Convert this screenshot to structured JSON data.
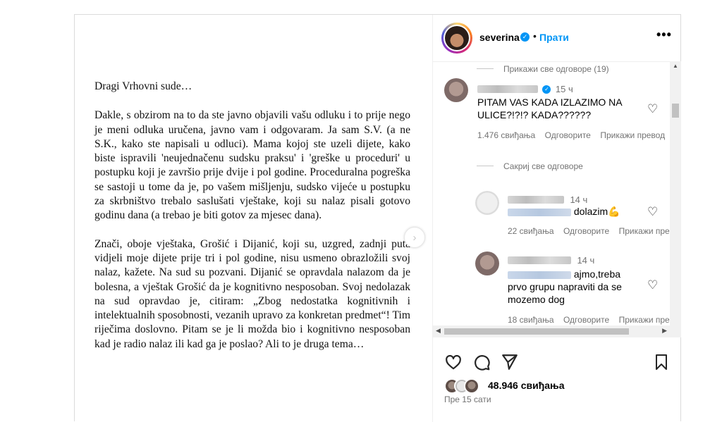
{
  "post": {
    "letter": {
      "greeting": "Dragi Vrhovni sude…",
      "paragraph1": "Dakle, s obzirom na to da ste javno objavili vašu odluku i to prije nego je meni odluka uručena, javno vam i odgovaram. Ja sam S.V. (a ne S.K., kako ste napisali u odluci). Mama kojoj ste uzeli dijete, kako biste ispravili 'neujednačenu sudsku praksu' i 'greške u proceduri' u postupku koji je završio prije dvije i pol godine. Proceduralna pogreška se sastoji u tome da je, po vašem mišljenju, sudsko vijeće u postupku za skrbništvo trebalo saslušati vještake, koji su nalaz pisali gotovo godinu dana (a trebao je biti gotov za mjesec dana).",
      "paragraph2": "Znači, oboje vještaka, Grošić i Dijanić, koji su, uzgred, zadnji puta vidjeli moje dijete prije tri i pol godine, nisu usmeno obrazložili svoj nalaz, kažete. Na sud su pozvani. Dijanić se opravdala nalazom da je bolesna, a vještak Grošić da je kognitivno nesposoban. Svoj nedolazak na sud opravdao je, citiram: „Zbog nedostatka kognitivnih i intelektualnih sposobnosti, vezanih upravo za konkretan predmet“! Tim riječima doslovno. Pitam se je li možda bio i kognitivno nesposoban kad je radio nalaz ili kad ga je poslao? Ali to je druga tema…"
    },
    "next_icon": "chevron-right-icon"
  },
  "header": {
    "username": "severina",
    "separator": "•",
    "follow_label": "Прати",
    "more_icon": "more-horizontal-icon"
  },
  "comments": {
    "show_all_replies_top": "Прикажи све одговоре (19)",
    "main": {
      "time": "15 ч",
      "text": "PITAM VAS KADA IZLAZIMO NA ULICE?!?!? KADA??????",
      "likes": "1.476 свиђања",
      "reply": "Одговорите",
      "translate": "Прикажи превод"
    },
    "hide_replies": "Сакриј све одговоре",
    "replies": [
      {
        "time": "14 ч",
        "text": "dolazim",
        "emoji": "💪",
        "likes": "22 свиђања",
        "reply": "Одговорите",
        "translate": "Прикажи превод"
      },
      {
        "time": "14 ч",
        "text": "ajmo,treba prvo grupu napraviti da se mozemo dog",
        "likes": "18 свиђања",
        "reply": "Одговорите",
        "translate": "Прикажи превод"
      }
    ]
  },
  "actions": {
    "like_icon": "heart-icon",
    "comment_icon": "comment-icon",
    "share_icon": "send-icon",
    "save_icon": "bookmark-icon",
    "likes_count": "48.946 свиђања",
    "posted_time": "Пре 15 сати"
  },
  "colors": {
    "accent": "#0095f6",
    "muted": "#737373",
    "border": "#dbdbdb"
  }
}
